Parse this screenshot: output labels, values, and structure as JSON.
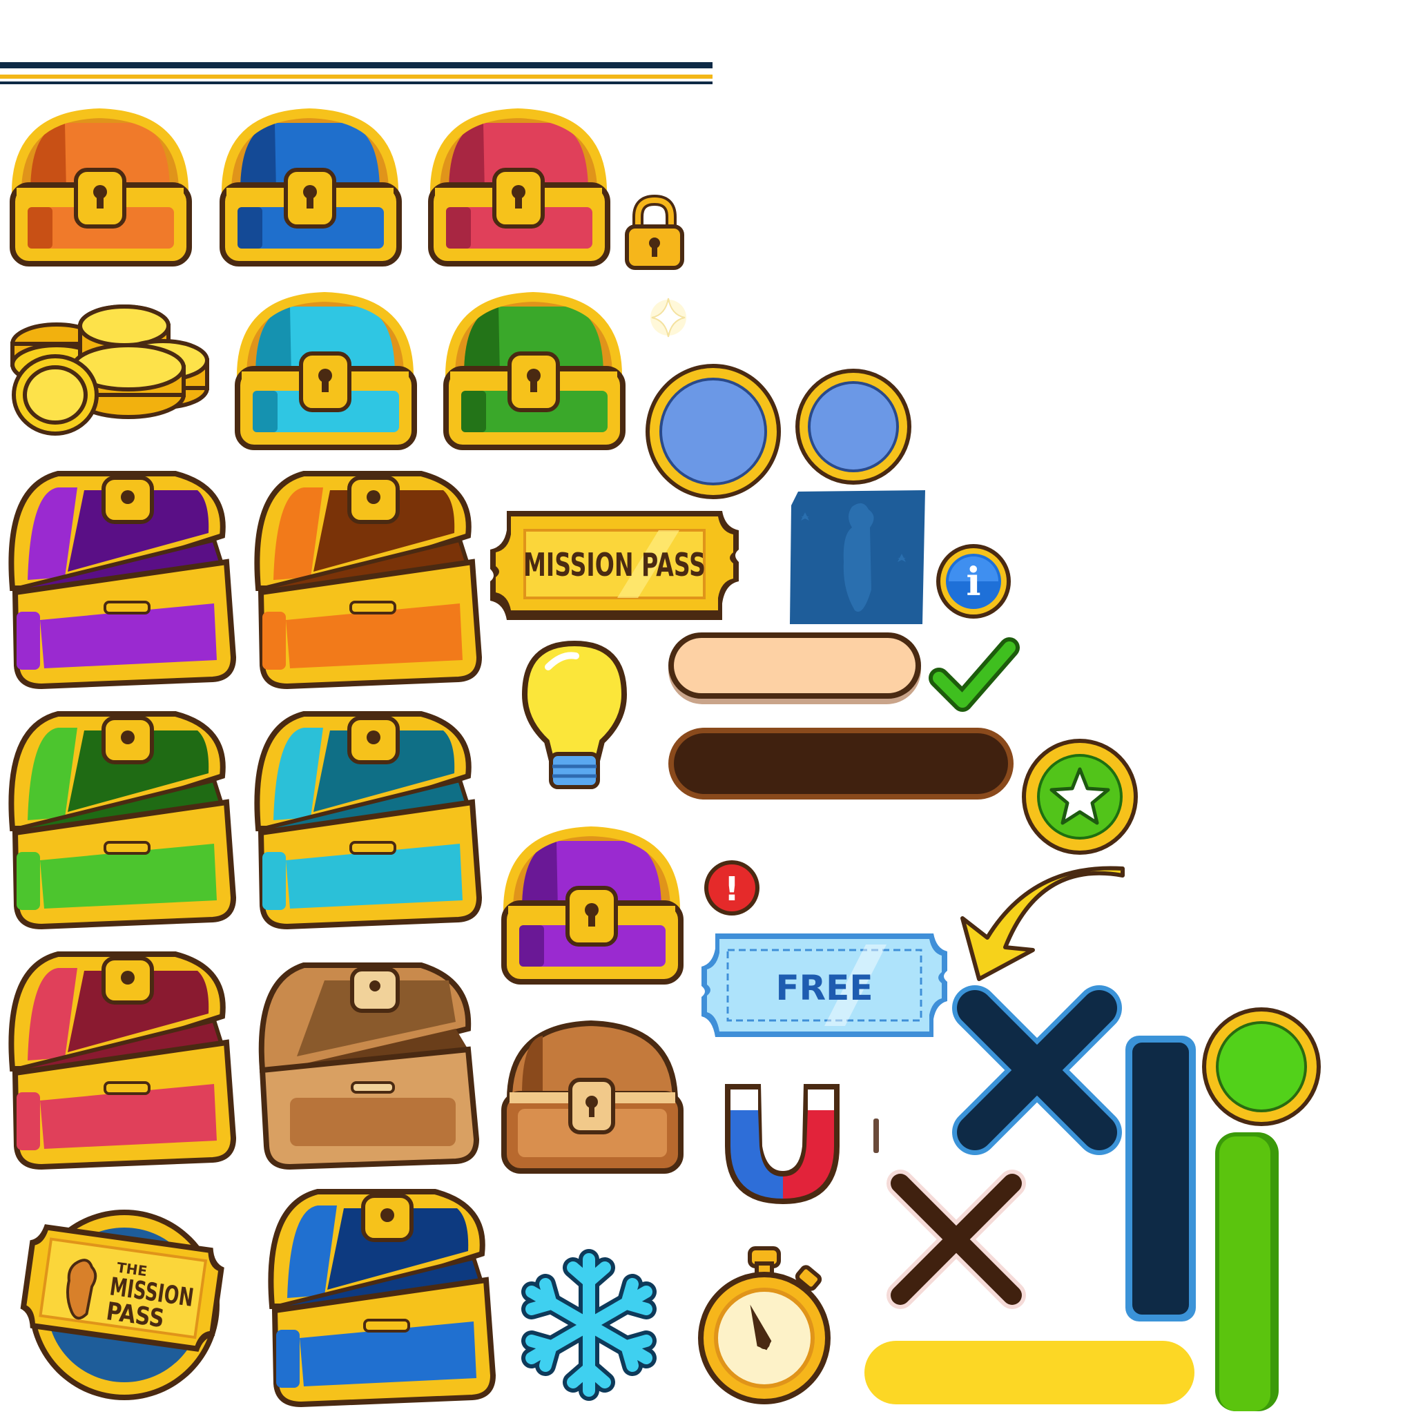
{
  "atlas": {
    "mission_pass_banner": {
      "label": "MISSION PASS"
    },
    "free_ticket": {
      "label": "FREE"
    },
    "mission_pass_badge": {
      "line1": "THE",
      "line2": "MISSION",
      "line3": "PASS"
    },
    "info_badge": {
      "glyph": "i"
    },
    "alert_badge": {
      "glyph": "!"
    }
  },
  "colors": {
    "gold": "#f6c21b",
    "gold_dark": "#e0941a",
    "outline": "#4a2a12",
    "navy": "#0e2a46",
    "blue_circle": "#6b98e6",
    "green_button": "#52c41a",
    "check_green": "#3fbf1f",
    "ticket_blue": "#aee3fb",
    "peach_bar": "#fdd1a4",
    "brown_bar": "#40210f",
    "yellow_bar": "#fcd725",
    "green_bar": "#5bc40e"
  },
  "closed_chests": [
    {
      "name": "orange",
      "lid": "#f07a2a",
      "lid_dark": "#c85015"
    },
    {
      "name": "blue",
      "lid": "#1f6fcc",
      "lid_dark": "#144a96"
    },
    {
      "name": "red",
      "lid": "#e0405a",
      "lid_dark": "#a82642"
    },
    {
      "name": "cyan",
      "lid": "#2fc6e3",
      "lid_dark": "#1592b0"
    },
    {
      "name": "green",
      "lid": "#3aa82a",
      "lid_dark": "#237418"
    },
    {
      "name": "purple",
      "lid": "#9a2ad0",
      "lid_dark": "#6a1896"
    }
  ],
  "open_chests": [
    {
      "name": "purple",
      "fill": "#9a2ad0",
      "dark": "#5a0f86"
    },
    {
      "name": "orange",
      "fill": "#f27a1a",
      "dark": "#7a3308"
    },
    {
      "name": "green",
      "fill": "#4cc52e",
      "dark": "#1f6b14"
    },
    {
      "name": "cyan",
      "fill": "#2bc0d8",
      "dark": "#0f6f86"
    },
    {
      "name": "red",
      "fill": "#e0405a",
      "dark": "#8a1a30"
    },
    {
      "name": "blue",
      "fill": "#2070d0",
      "dark": "#0d3a80"
    }
  ]
}
